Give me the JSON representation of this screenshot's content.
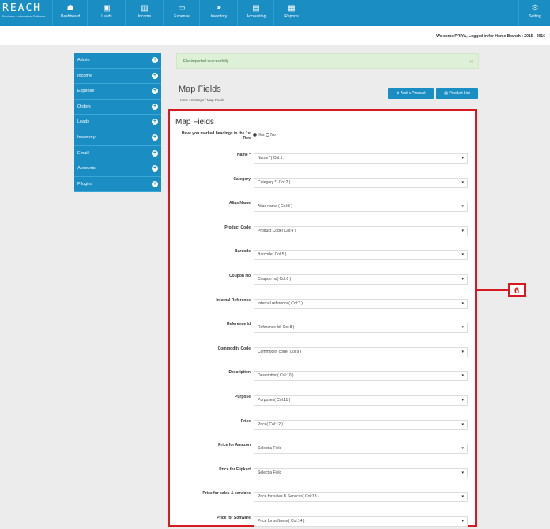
{
  "brand": {
    "name": "REACH",
    "tagline": "Business Automation Software"
  },
  "nav": [
    {
      "label": "Dashboard",
      "icon": "dashboard-icon",
      "glyph": "☗"
    },
    {
      "label": "Leads",
      "icon": "leads-icon",
      "glyph": "▣"
    },
    {
      "label": "Income",
      "icon": "income-icon",
      "glyph": "▥"
    },
    {
      "label": "Expense",
      "icon": "expense-icon",
      "glyph": "▭"
    },
    {
      "label": "Inventory",
      "icon": "inventory-icon",
      "glyph": "⚭"
    },
    {
      "label": "Accounting",
      "icon": "accounting-icon",
      "glyph": "▤"
    },
    {
      "label": "Reports",
      "icon": "reports-icon",
      "glyph": "▦"
    }
  ],
  "settings": {
    "label": "Setting",
    "glyph": "⚙"
  },
  "welcome": "Welcome PRIYA, Logged in for Home Branch : 2015 - 2016",
  "sidebar": [
    "Admin",
    "Income",
    "Expense",
    "Orders",
    "Leads",
    "Inventory",
    "Email",
    "Accounts",
    "Pllugins"
  ],
  "alert": {
    "text": "File imported successfully",
    "close": "×"
  },
  "page": {
    "title": "Map Fields",
    "crumbs": [
      "Home",
      "Settings",
      "Map Fields"
    ]
  },
  "buttons": {
    "add_product": "Add a Product",
    "product_list": "Product List"
  },
  "panel": {
    "title": "Map Fields",
    "headings_question": "Have you marked headings in the 1st Row",
    "yes": "Yes",
    "no": "No"
  },
  "fields": [
    {
      "label": "Name *",
      "value": "Name *( Col:1 )"
    },
    {
      "label": "Category",
      "value": "Category *( Col:2 )"
    },
    {
      "label": "Alias Name",
      "value": "Alias name ( Col:3 )"
    },
    {
      "label": "Product Code",
      "value": "Product Code( Col:4 )"
    },
    {
      "label": "Barcode",
      "value": "Barcode( Col:5 )"
    },
    {
      "label": "Coupon No",
      "value": "Coupon no( Col:6 )"
    },
    {
      "label": "Internal Reference",
      "value": "Internal reference( Col:7 )"
    },
    {
      "label": "Reference Id",
      "value": "Reference Id( Col:8 )"
    },
    {
      "label": "Commodity Code",
      "value": "Commodity code( Col:9 )"
    },
    {
      "label": "Description",
      "value": "Description( Col:10 )"
    },
    {
      "label": "Purpose",
      "value": "Purposes( Col:11 )"
    },
    {
      "label": "Price",
      "value": "Price( Col:12 )"
    },
    {
      "label": "Price for Amazon",
      "value": "Select a Field"
    },
    {
      "label": "Price for Flipkart",
      "value": "Select a Field"
    },
    {
      "label": "Price for sales & services",
      "value": "Price for sales & Services( Col:13 )"
    },
    {
      "label": "Price for Software",
      "value": "Price for software( Col:14 )"
    }
  ],
  "callout": "6",
  "colors": {
    "primary": "#1a8dc3",
    "annotation": "#d71920",
    "alert_bg": "#dff0d8"
  }
}
